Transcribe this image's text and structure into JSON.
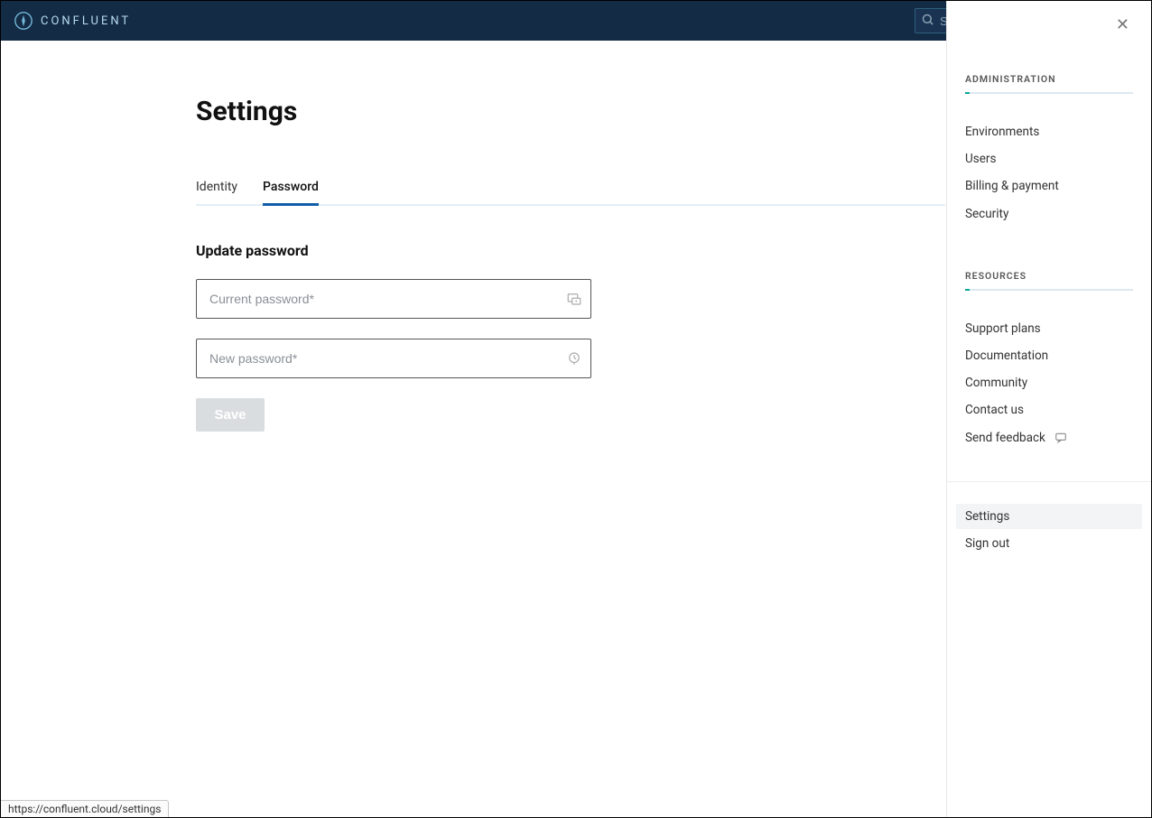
{
  "brand": "CONFLUENT",
  "search": {
    "placeholder": "Search"
  },
  "page": {
    "title": "Settings",
    "section_heading": "Update password"
  },
  "tabs": [
    {
      "label": "Identity",
      "active": false
    },
    {
      "label": "Password",
      "active": true
    }
  ],
  "form": {
    "current_placeholder": "Current password*",
    "new_placeholder": "New password*",
    "save_label": "Save"
  },
  "panel": {
    "admin_title": "ADMINISTRATION",
    "resources_title": "RESOURCES",
    "admin_items": [
      "Environments",
      "Users",
      "Billing & payment",
      "Security"
    ],
    "resource_items": [
      "Support plans",
      "Documentation",
      "Community",
      "Contact us",
      "Send feedback"
    ],
    "bottom_items": [
      "Settings",
      "Sign out"
    ],
    "bottom_active_index": 0
  },
  "status_url": "https://confluent.cloud/settings"
}
